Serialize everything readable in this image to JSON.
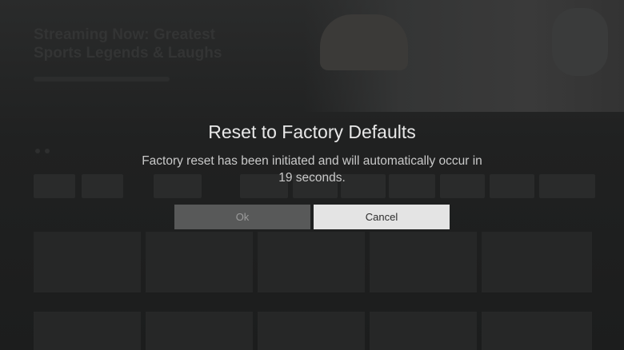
{
  "background": {
    "hero_title": "Streaming Now: Greatest Sports Legends & Laughs"
  },
  "dialog": {
    "title": "Reset to Factory Defaults",
    "message": "Factory reset has been initiated and will automatically occur in 19 seconds.",
    "countdown_seconds": 19,
    "buttons": {
      "ok_label": "Ok",
      "cancel_label": "Cancel",
      "focused": "Cancel"
    }
  },
  "colors": {
    "overlay": "#1d1e1e",
    "title_text": "#e8e8e8",
    "message_text": "#c9c9c9",
    "ok_button_bg": "#585959",
    "cancel_button_bg": "#e4e4e4"
  }
}
